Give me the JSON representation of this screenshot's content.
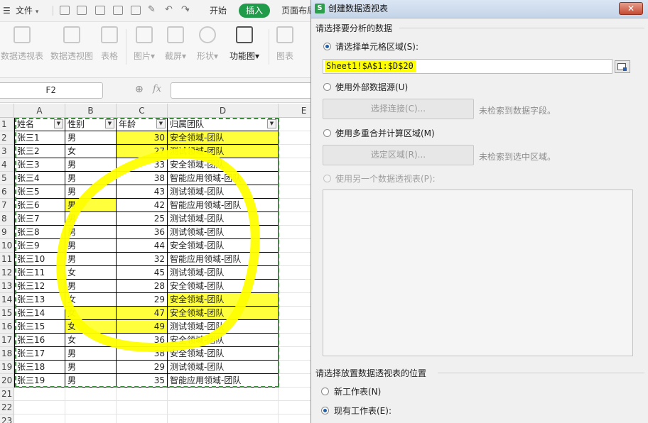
{
  "menubar": {
    "file_label": "文件",
    "tabs": [
      "开始",
      "插入",
      "页面布局"
    ]
  },
  "ribbon": {
    "buttons": [
      "数据透视表",
      "数据透视图",
      "表格",
      "图片",
      "截屏",
      "形状",
      "功能图",
      "图表"
    ]
  },
  "formula_bar": {
    "cell_ref": "F2",
    "fx_label": "fx"
  },
  "sheet": {
    "columns": [
      "A",
      "B",
      "C",
      "D",
      "E"
    ],
    "row_numbers": [
      "1",
      "2",
      "3",
      "4",
      "5",
      "6",
      "7",
      "8",
      "9",
      "10",
      "11",
      "12",
      "13",
      "14",
      "15",
      "16",
      "17",
      "18",
      "19",
      "20",
      "21",
      "22",
      "23"
    ],
    "header": [
      "姓名",
      "性别",
      "年龄",
      "归属团队"
    ],
    "rows": [
      [
        "张三1",
        "男",
        "30",
        "安全领域-团队"
      ],
      [
        "张三2",
        "女",
        "27",
        "测试领域-团队"
      ],
      [
        "张三3",
        "男",
        "33",
        "安全领域-团队"
      ],
      [
        "张三4",
        "男",
        "38",
        "智能应用领域-团队"
      ],
      [
        "张三5",
        "男",
        "43",
        "测试领域-团队"
      ],
      [
        "张三6",
        "男",
        "42",
        "智能应用领域-团队"
      ],
      [
        "张三7",
        "男",
        "25",
        "测试领域-团队"
      ],
      [
        "张三8",
        "男",
        "36",
        "测试领域-团队"
      ],
      [
        "张三9",
        "男",
        "44",
        "安全领域-团队"
      ],
      [
        "张三10",
        "男",
        "32",
        "智能应用领域-团队"
      ],
      [
        "张三11",
        "女",
        "45",
        "测试领域-团队"
      ],
      [
        "张三12",
        "男",
        "28",
        "安全领域-团队"
      ],
      [
        "张三13",
        "女",
        "29",
        "安全领域-团队"
      ],
      [
        "张三14",
        "女",
        "47",
        "安全领域-团队"
      ],
      [
        "张三15",
        "女",
        "49",
        "测试领域-团队"
      ],
      [
        "张三16",
        "女",
        "36",
        "安全领域-团队"
      ],
      [
        "张三17",
        "男",
        "38",
        "安全领域-团队"
      ],
      [
        "张三18",
        "男",
        "29",
        "测试领域-团队"
      ],
      [
        "张三19",
        "男",
        "35",
        "智能应用领域-团队"
      ]
    ],
    "accent_color": "#ffff00",
    "marquee_color": "#3a8d3a"
  },
  "dialog": {
    "title": "创建数据透视表",
    "close_label": "✕",
    "section1": "请选择要分析的数据",
    "opt_range_label": "请选择单元格区域(S):",
    "range_value": "Sheet1!$A$1:$D$20",
    "opt_external_label": "使用外部数据源(U)",
    "choose_conn_button": "选择连接(C)...",
    "no_fields_hint": "未检索到数据字段。",
    "opt_multi_label": "使用多重合并计算区域(M)",
    "select_area_button": "选定区域(R)...",
    "no_area_hint": "未检索到选中区域。",
    "opt_other_pivot_label": "使用另一个数据透视表(P):",
    "section2": "请选择放置数据透视表的位置",
    "new_sheet_label": "新工作表(N)",
    "existing_sheet_label": "现有工作表(E):"
  }
}
